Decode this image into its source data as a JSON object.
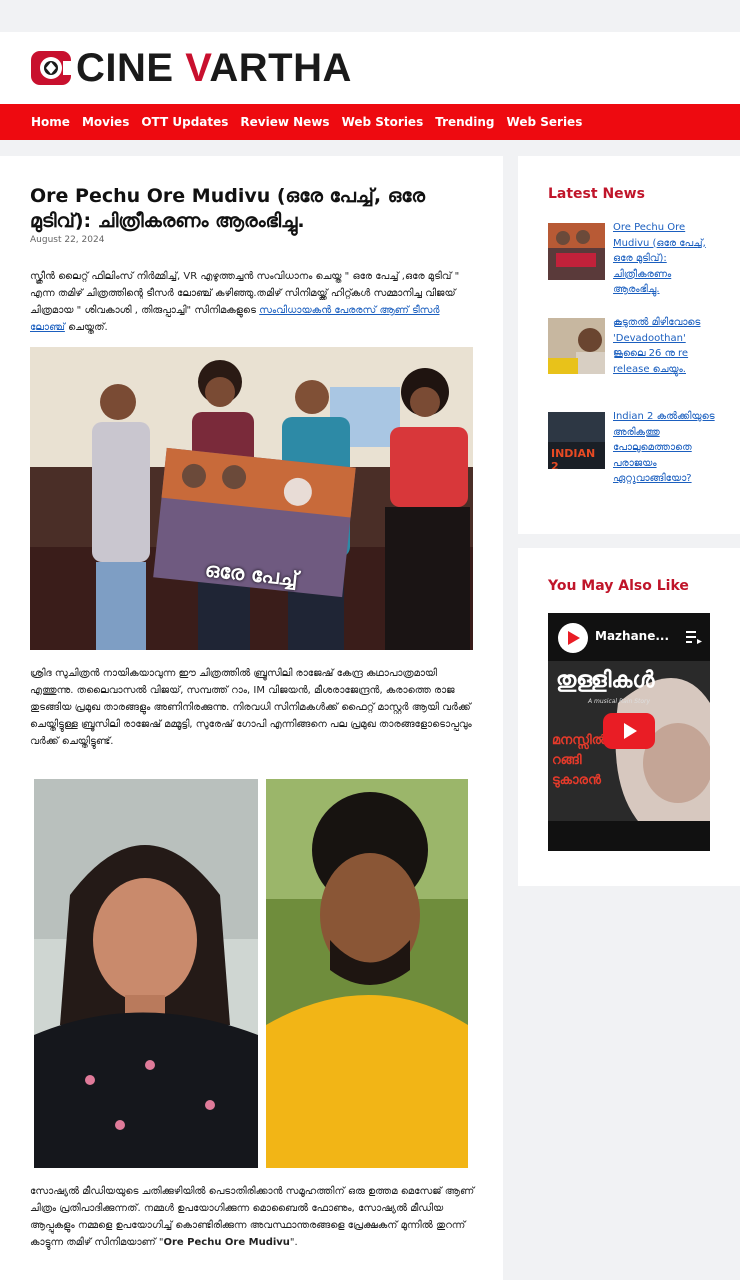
{
  "site": {
    "logo_text_a": "CINE ",
    "logo_accent": "V",
    "logo_text_b": "ARTHA",
    "brand_color": "#c8102e",
    "nav_color": "#ee0a10"
  },
  "nav": [
    "Home",
    "Movies",
    "OTT Updates",
    "Review News",
    "Web Stories",
    "Trending",
    "Web Series"
  ],
  "article": {
    "title": "Ore Pechu Ore Mudivu (ഒരേ പേച്ച്, ഒരേ മുടിവ്): ചിത്രീകരണം ആരംഭിച്ചു.",
    "date": "August 22, 2024",
    "p1_text": "സ്ക്രീൻ ലൈറ്റ് ഫിലിംസ് നിർമ്മിച്ച്, VR എഴുത്തച്ചൻ സംവിധാനം ചെയ്ത \" ഒരേ പേച്ച് ,ഒരേ മുടിവ് \" എന്ന തമിഴ് ചിത്രത്തിന്റെ ടീസർ ലോഞ്ച് കഴിഞ്ഞു.തമിഴ് സിനിമയ്ക്ക് ഹിറ്റ്കൾ സമ്മാനിച്ച വിജയ് ചിത്രമായ \" ശിവകാശി , തിരുപ്പാച്ചി\" സിനിമകളുടെ ",
    "p1_link": "സംവിധായകൻ പേരരസ് ആണ് ടീസർ ലോഞ്ച്",
    "p1_end": " ചെയ്തത്.",
    "p2": "ശ്രിദ സുചിത്രൻ നായികയാവുന്ന ഈ ചിത്രത്തിൽ ബ്രൂസിലി രാജേഷ് കേന്ദ്ര കഥാപാത്രമായി എത്തുന്നു. തലൈവാസൽ വിജയ്, സമ്പത്ത് റാം, IM വിജയൻ, മീശരാജേന്ദ്രൻ, കരാത്തെ രാജ തുടങ്ങിയ പ്രമുഖ താരങ്ങളും അണിനിരക്കുന്നു. നിരവധി സിനിമകൾക്ക് ഫൈറ്റ് മാസ്റ്റർ ആയി വർക്ക് ചെയ്തിട്ടുള്ള ബ്രൂസിലി രാജേഷ് മമ്മൂട്ടി, സുരേഷ് ഗോപി എന്നിങ്ങനെ പല പ്രമുഖ താരങ്ങളോടൊപ്പവും വർക്ക് ചെയ്തിട്ടുണ്ട്.",
    "p3_text": "സോഷ്യൽ മീഡിയയുടെ ചതിക്കുഴിയിൽ പെടാതിരിക്കാൻ സമൂഹത്തിന് ഒരു ഉത്തമ മെസേജ് ആണ് ചിത്രം പ്രതിപാദിക്കുന്നത്. നമ്മൾ ഉപയോഗിക്കുന്ന മൊബൈൽ ഫോണും, സോഷ്യൽ മീഡിയ ആപ്പുകളും നമ്മളെ ഉപയോഗിച്ച് കൊണ്ടിരിക്കുന്ന അവസ്ഥാന്തരങ്ങളെ പ്രേക്ഷകന് മുന്നിൽ തുറന്ന് കാട്ടുന്ന തമിഴ് സിനിമയാണ് \"",
    "p3_bold": "Ore Pechu Ore Mudivu",
    "p3_end": "\".",
    "poster_text": "ഒരേ പേച്ച്"
  },
  "sidebar": {
    "latest_heading": "Latest News",
    "latest": [
      {
        "title": "Ore Pechu Ore Mudivu (ഒരേ പേച്ച്, ഒരേ മുടിവ്): ചിത്രീകരണം ആരംഭിച്ചു."
      },
      {
        "title": "കൂടുതൽ മിഴിവോടെ 'Devadoothan' ജൂലൈ 26 നു re release ചെയ്യും."
      },
      {
        "title": "Indian 2 കൽക്കിയുടെ അരികത്തു പോലുമെത്താതെ പരാജയം ഏറ്റുവാങ്ങിയോ?",
        "thumb_text": "INDIAN 2"
      }
    ],
    "also_heading": "You May Also Like",
    "video": {
      "title": "Mazhane...",
      "overlay_title": "തുള്ളികൾ",
      "overlay_sub": "A musical Rain Story",
      "overlay_lines": [
        "മനസ്സിൽ",
        "റങ്ങി",
        "ടുകാരൻ"
      ]
    }
  }
}
